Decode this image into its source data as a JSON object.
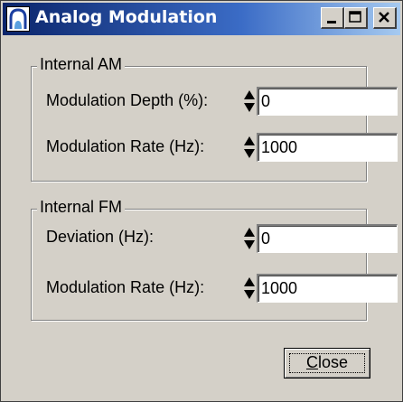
{
  "window": {
    "title": "Analog Modulation",
    "icon": "app-bell-icon",
    "controls": {
      "minimize": "minimize-icon",
      "maximize": "maximize-icon",
      "close": "close-icon"
    }
  },
  "internal_am": {
    "title": "Internal AM",
    "depth_label": "Modulation Depth (%):",
    "depth_value": "0",
    "rate_label": "Modulation Rate (Hz):",
    "rate_value": "1000"
  },
  "internal_fm": {
    "title": "Internal FM",
    "deviation_label": "Deviation (Hz):",
    "deviation_value": "0",
    "rate_label": "Modulation Rate (Hz):",
    "rate_value": "1000"
  },
  "close_button": {
    "mnemonic": "C",
    "rest": "lose"
  }
}
